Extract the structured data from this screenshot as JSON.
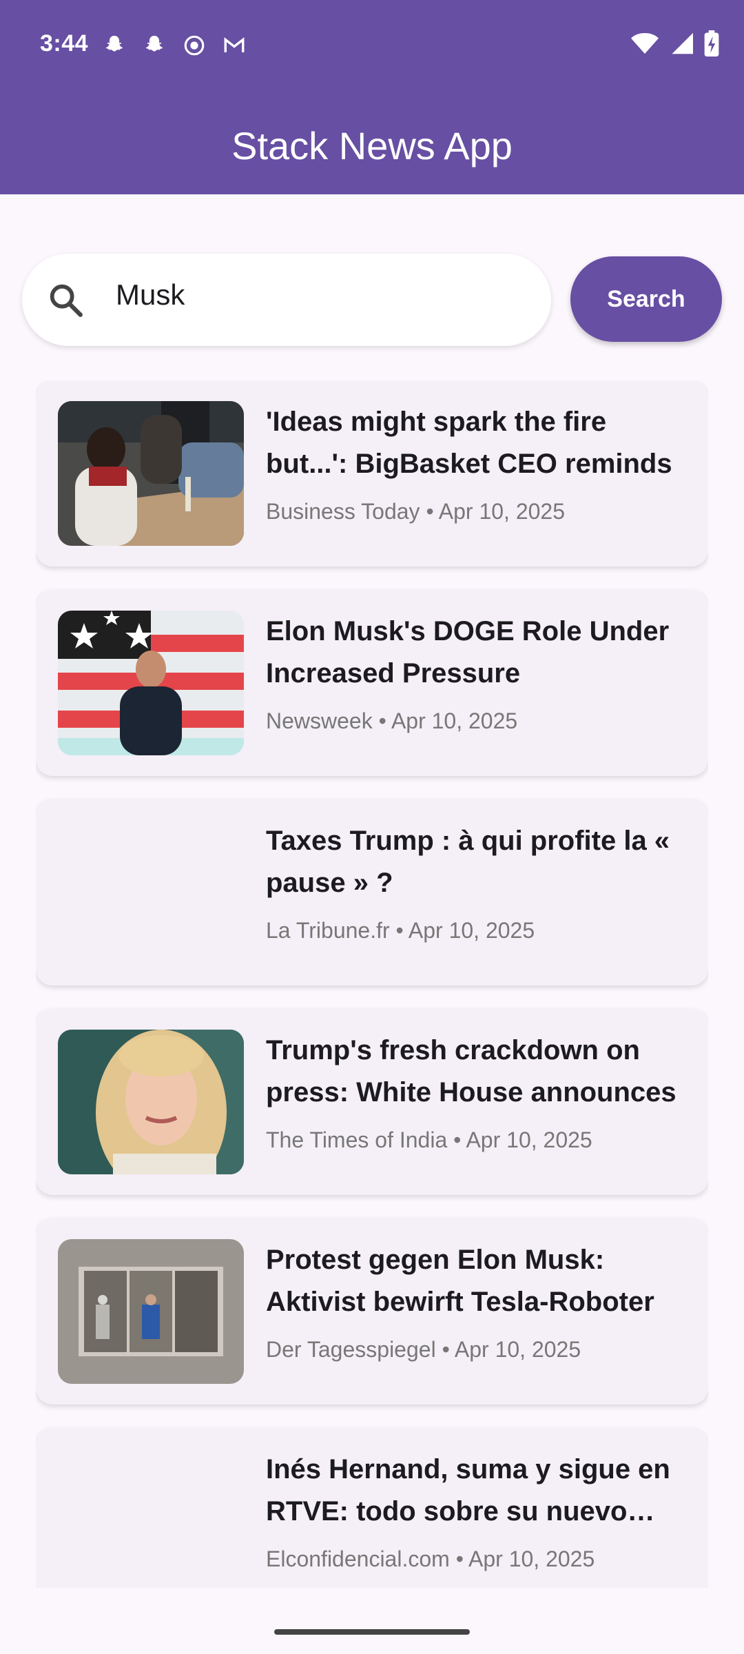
{
  "status_bar": {
    "time": "3:44",
    "left_icons": [
      "snapchat-icon",
      "snapchat-icon",
      "screen-record-icon",
      "gmail-icon"
    ],
    "right_icons": [
      "wifi-icon",
      "signal-icon",
      "battery-charging-icon"
    ]
  },
  "app_bar": {
    "title": "Stack News App"
  },
  "search": {
    "value": "Musk",
    "button_label": "Search",
    "icon": "search-icon"
  },
  "colors": {
    "primary": "#674FA3",
    "background": "#FCF7FD",
    "card": "#F5EFF7"
  },
  "articles": [
    {
      "title": "'Ideas might spark the fire but...': BigBasket CEO reminds",
      "source": "Business Today",
      "date": "Apr 10, 2025",
      "thumbnail": "team-meeting-photo"
    },
    {
      "title": "Elon Musk's DOGE Role Under Increased Pressure",
      "source": "Newsweek",
      "date": "Apr 10, 2025",
      "thumbnail": "elon-musk-flag-photo"
    },
    {
      "title": "Taxes Trump : à qui profite la « pause » ?",
      "source": "La Tribune.fr",
      "date": "Apr 10, 2025",
      "thumbnail": ""
    },
    {
      "title": "Trump's fresh crackdown on press: White House announces",
      "source": "The Times of India",
      "date": "Apr 10, 2025",
      "thumbnail": "press-secretary-photo"
    },
    {
      "title": "Protest gegen Elon Musk: Aktivist bewirft Tesla-Roboter",
      "source": "Der Tagesspiegel",
      "date": "Apr 10, 2025",
      "thumbnail": "tesla-showroom-photo"
    },
    {
      "title": "Inés Hernand, suma y sigue en RTVE: todo sobre su nuevo programa",
      "source": "Elconfidencial.com",
      "date": "Apr 10, 2025",
      "thumbnail": ""
    }
  ],
  "meta_separator": " • "
}
